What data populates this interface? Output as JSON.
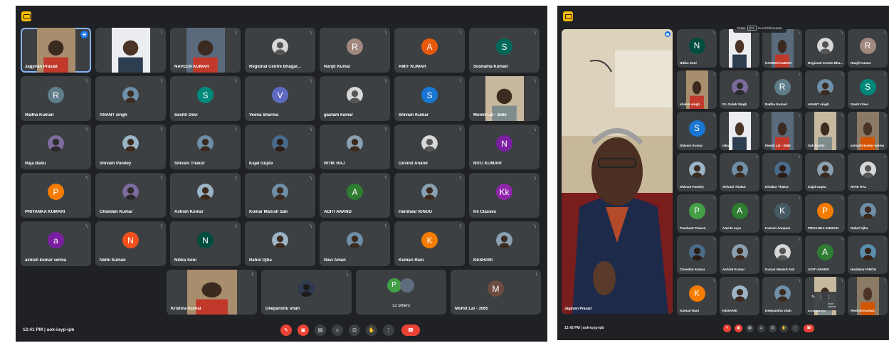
{
  "left": {
    "time": "12:41 PM  |  aok-iuyp-ipb",
    "tiles": [
      {
        "name": "Jagjivan Prasad",
        "kind": "video",
        "speaking": true
      },
      {
        "name": "",
        "kind": "video"
      },
      {
        "name": "NAVEEN KUMAR",
        "kind": "video"
      },
      {
        "name": "Regional Centre Bhagal...",
        "kind": "photo"
      },
      {
        "name": "Ranjit Kumar",
        "kind": "letter",
        "letter": "R",
        "color": "#a1887f"
      },
      {
        "name": "AMIT KUMAR",
        "kind": "letter",
        "letter": "A",
        "color": "#e8590c"
      },
      {
        "name": "Sushama Kumari",
        "kind": "letter",
        "letter": "S",
        "color": "#00695c"
      },
      {
        "name": "Radha Kumari",
        "kind": "letter",
        "letter": "R",
        "color": "#607d8b"
      },
      {
        "name": "ANANT singh",
        "kind": "photo"
      },
      {
        "name": "Savitri Devi",
        "kind": "letter",
        "letter": "S",
        "color": "#00897b"
      },
      {
        "name": "Veena Sharma",
        "kind": "letter",
        "letter": "V",
        "color": "#5c6bc0"
      },
      {
        "name": "gautam kumar",
        "kind": "photo"
      },
      {
        "name": "Shivam Kumar",
        "kind": "letter",
        "letter": "S",
        "color": "#1976d2"
      },
      {
        "name": "Momit Lal - 3565",
        "kind": "video"
      },
      {
        "name": "Raja Babu",
        "kind": "photo"
      },
      {
        "name": "Shivam Pandey",
        "kind": "photo"
      },
      {
        "name": "Shivani Thakur",
        "kind": "photo"
      },
      {
        "name": "Kajal Gupta",
        "kind": "photo"
      },
      {
        "name": "RITIK RAJ",
        "kind": "photo"
      },
      {
        "name": "Govind Anand",
        "kind": "photo"
      },
      {
        "name": "NITU KUMARI",
        "kind": "letter",
        "letter": "N",
        "color": "#7b1fa2"
      },
      {
        "name": "PRIYANKA KUMARI",
        "kind": "letter",
        "letter": "P",
        "color": "#f57c00"
      },
      {
        "name": "Chandan Kumar",
        "kind": "photo"
      },
      {
        "name": "Ashish Kumar",
        "kind": "photo"
      },
      {
        "name": "Kumar Manish Sah",
        "kind": "photo"
      },
      {
        "name": "ADITI ANAND",
        "kind": "letter",
        "letter": "A",
        "color": "#2e7d32"
      },
      {
        "name": "Haridwar IGNOU",
        "kind": "photo"
      },
      {
        "name": "Kk Classes",
        "kind": "letter",
        "letter": "Kk",
        "color": "#8e24aa"
      },
      {
        "name": "avnish kumar verma",
        "kind": "letter",
        "letter": "a",
        "color": "#7b1fa2"
      },
      {
        "name": "Nidhi Suman",
        "kind": "letter",
        "letter": "N",
        "color": "#f4511e"
      },
      {
        "name": "Nitika Soni",
        "kind": "letter",
        "letter": "N",
        "color": "#004d40"
      },
      {
        "name": "Rahul Ojha",
        "kind": "photo"
      },
      {
        "name": "Ravi Aman",
        "kind": "photo"
      },
      {
        "name": "Kumari Rani",
        "kind": "letter",
        "letter": "K",
        "color": "#f57c00"
      },
      {
        "name": "KESHARI",
        "kind": "photo"
      },
      {
        "name": "Krishna Kumar",
        "kind": "video"
      },
      {
        "name": "Deepanshu shah",
        "kind": "photo"
      },
      {
        "name": "12 others",
        "kind": "others"
      },
      {
        "name": "Momit Lal - 3565",
        "kind": "letter",
        "letter": "M",
        "color": "#6d4c41"
      }
    ]
  },
  "right": {
    "time": "12:42 PM  |  aok-iuyp-ipb",
    "main_name": "Jagjivan Prasad",
    "fullscreen_hint": {
      "pre": "Press",
      "key": "Esc",
      "post": "to exit full screen"
    },
    "more_options": "More options",
    "tiles": [
      {
        "name": "Nitika Soni",
        "kind": "letter",
        "letter": "N",
        "color": "#004d40"
      },
      {
        "name": "",
        "kind": "video"
      },
      {
        "name": "NAVEEN KUMAR",
        "kind": "video"
      },
      {
        "name": "Regional Centre Bha...",
        "kind": "photo"
      },
      {
        "name": "Ranjit Kumar",
        "kind": "letter",
        "letter": "R",
        "color": "#a1887f"
      },
      {
        "name": "shalini singh",
        "kind": "video"
      },
      {
        "name": "Dr. Gulab Singh",
        "kind": "photo"
      },
      {
        "name": "Radha Kumari",
        "kind": "letter",
        "letter": "R",
        "color": "#607d8b"
      },
      {
        "name": "ANANT singh",
        "kind": "photo"
      },
      {
        "name": "Savitri Devi",
        "kind": "letter",
        "letter": "S",
        "color": "#00897b"
      },
      {
        "name": "Shivam Kumar",
        "kind": "letter",
        "letter": "S",
        "color": "#1976d2"
      },
      {
        "name": "vikash",
        "kind": "video"
      },
      {
        "name": "Momit Lal - 3565",
        "kind": "video"
      },
      {
        "name": "Sah Kavita",
        "kind": "video"
      },
      {
        "name": "avinash kumar verma",
        "kind": "video"
      },
      {
        "name": "Shivam Pandey",
        "kind": "photo"
      },
      {
        "name": "Shivani Thakur",
        "kind": "photo"
      },
      {
        "name": "Divakar Thakur",
        "kind": "photo"
      },
      {
        "name": "Kajal Gupta",
        "kind": "photo"
      },
      {
        "name": "RITIK RAJ",
        "kind": "photo"
      },
      {
        "name": "Prashant Prasun",
        "kind": "letter",
        "letter": "P",
        "color": "#43a047"
      },
      {
        "name": "Amrita Arya",
        "kind": "letter",
        "letter": "A",
        "color": "#2e7d32"
      },
      {
        "name": "Kumari Anupam",
        "kind": "letter",
        "letter": "K",
        "color": "#455a64"
      },
      {
        "name": "PRIYANKA KUMARI",
        "kind": "letter",
        "letter": "P",
        "color": "#f57c00"
      },
      {
        "name": "Rahul Ojha",
        "kind": "photo"
      },
      {
        "name": "Chandan Kumar",
        "kind": "photo"
      },
      {
        "name": "Ashish Kumar",
        "kind": "photo"
      },
      {
        "name": "Kumar Manish Sah",
        "kind": "photo"
      },
      {
        "name": "ADITI ANAND",
        "kind": "letter",
        "letter": "A",
        "color": "#2e7d32"
      },
      {
        "name": "Haridwar IGNOU",
        "kind": "photo"
      },
      {
        "name": "Kumari Rani",
        "kind": "letter",
        "letter": "K",
        "color": "#f57c00"
      },
      {
        "name": "KESHARI",
        "kind": "photo"
      },
      {
        "name": "Deepanshu shah",
        "kind": "photo"
      },
      {
        "name": "Krishna Ku",
        "kind": "video"
      },
      {
        "name": "Reshmi Kumari",
        "kind": "video"
      }
    ]
  }
}
